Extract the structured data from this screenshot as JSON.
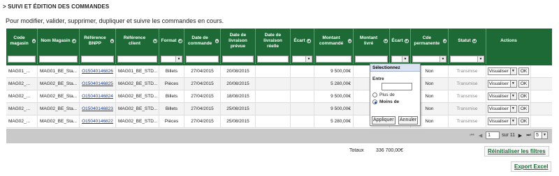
{
  "section_title": "> SUIVI ET ÉDITION DES COMMANDES",
  "subtitle": "Pour modifier, valider, supprimer, dupliquer et suivre les commandes en cours.",
  "columns": [
    {
      "label": "Code magasin",
      "sort": true
    },
    {
      "label": "Nom Magasin",
      "sort": true
    },
    {
      "label": "Référence BNPP",
      "sort": true
    },
    {
      "label": "Référence client",
      "sort": true
    },
    {
      "label": "Format",
      "sort": true
    },
    {
      "label": "Date de commande",
      "sort": true
    },
    {
      "label": "Date de livraison prévue",
      "sort": false
    },
    {
      "label": "Date de livraison réelle",
      "sort": false
    },
    {
      "label": "Écart",
      "sort": true
    },
    {
      "label": "Montant commandé",
      "sort": true
    },
    {
      "label": "Montant livré",
      "sort": true
    },
    {
      "label": "Écart",
      "sort": true
    },
    {
      "label": "Cde permanente",
      "sort": true
    },
    {
      "label": "Statut",
      "sort": true
    },
    {
      "label": "Actions",
      "sort": false
    }
  ],
  "rows": [
    {
      "code": "MAG01_...",
      "nom": "MAG01_BE_Sta...",
      "ref_bnpp": "O15040146826",
      "ref_client": "MAG01_BE_STD...",
      "format": "Billets",
      "date_cmd": "27/04/2015",
      "date_prevue": "20/08/2015",
      "date_reelle": "",
      "ecart": "",
      "montant_cmd": "9 500,00€",
      "montant_livre": "",
      "ecart2": "",
      "permanente": "Non",
      "statut": "Transmise",
      "action": "Visualiser",
      "ok": "OK"
    },
    {
      "code": "MAG02_...",
      "nom": "MAG02_BE_Sta...",
      "ref_bnpp": "O15040146825",
      "ref_client": "MAG02_BE_STD...",
      "format": "Pièces",
      "date_cmd": "27/04/2015",
      "date_prevue": "20/08/2015",
      "date_reelle": "",
      "ecart": "",
      "montant_cmd": "5 280,00€",
      "montant_livre": "",
      "ecart2": "",
      "permanente": "Non",
      "statut": "Transmise",
      "action": "Visualiser",
      "ok": "OK"
    },
    {
      "code": "MAG02_...",
      "nom": "MAG02_BE_Sta...",
      "ref_bnpp": "O15040146824",
      "ref_client": "MAG02_BE_STD...",
      "format": "Billets",
      "date_cmd": "27/04/2015",
      "date_prevue": "18/08/2015",
      "date_reelle": "",
      "ecart": "",
      "montant_cmd": "9 500,00€",
      "montant_livre": "",
      "ecart2": "",
      "permanente": "Non",
      "statut": "Transmise",
      "action": "Visualiser",
      "ok": "OK"
    },
    {
      "code": "MAG02_...",
      "nom": "MAG02_BE_Sta...",
      "ref_bnpp": "O15040146823",
      "ref_client": "MAG02_BE_STD...",
      "format": "Billets",
      "date_cmd": "27/04/2015",
      "date_prevue": "25/08/2015",
      "date_reelle": "",
      "ecart": "",
      "montant_cmd": "9 500,00€",
      "montant_livre": "",
      "ecart2": "",
      "permanente": "Non",
      "statut": "Transmise",
      "action": "Visualiser",
      "ok": "OK"
    },
    {
      "code": "MAG02_...",
      "nom": "MAG02_BE_Sta...",
      "ref_bnpp": "O15040146822",
      "ref_client": "MAG02_BE_STD...",
      "format": "Pièces",
      "date_cmd": "27/04/2015",
      "date_prevue": "25/08/2015",
      "date_reelle": "",
      "ecart": "",
      "montant_cmd": "5 280,00€",
      "montant_livre": "",
      "ecart2": "",
      "permanente": "Non",
      "statut": "Transmise",
      "action": "Visualiser",
      "ok": "OK"
    }
  ],
  "popup": {
    "header": "Sélectionnez",
    "label": "Entre",
    "option_plus": "Plus de",
    "option_moins": "Moins de",
    "selected": "Moins de",
    "apply": "Appliquer",
    "cancel": "Annuler"
  },
  "pager": {
    "first": "⏮",
    "prev": "◀",
    "current_page": "1",
    "of_label": "sur 11",
    "next": "▶",
    "last": "⏭",
    "page_size": "5"
  },
  "totals": {
    "label": "Totaux",
    "value": "336 700,00€"
  },
  "buttons": {
    "reset": "Réinitialiser les filtres",
    "export": "Export Excel"
  },
  "colors": {
    "header_green": "#1d6a36",
    "link_blue": "#1a3d8c",
    "pager_gray": "#c9c9c9"
  }
}
